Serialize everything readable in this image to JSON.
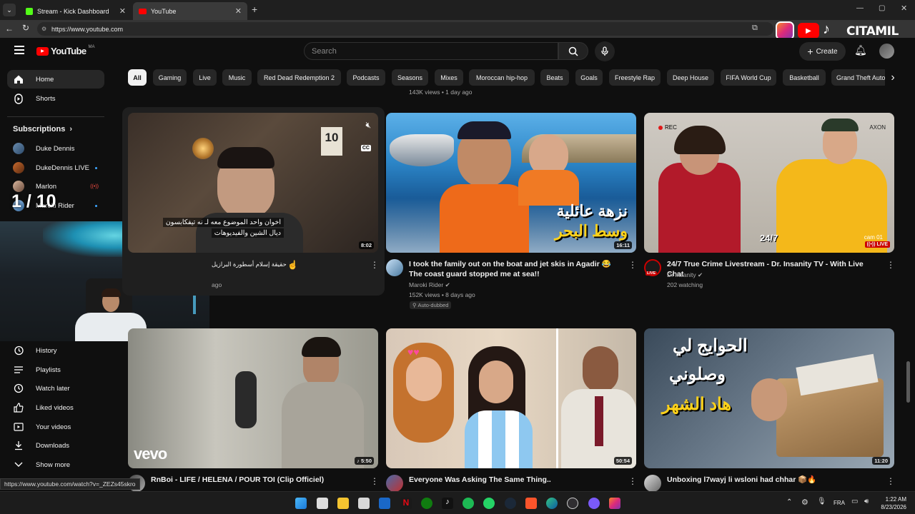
{
  "browser": {
    "tabs": [
      {
        "title": "Stream - Kick Dashboard"
      },
      {
        "title": "YouTube"
      }
    ],
    "url": "https://www.youtube.com",
    "status_url": "https://www.youtube.com/watch?v=_ZEZs45skro"
  },
  "youtube": {
    "logo_text": "YouTube",
    "country": "MA",
    "search_placeholder": "Search",
    "create_label": "Create"
  },
  "sidebar": {
    "home": "Home",
    "shorts": "Shorts",
    "subscriptions_header": "Subscriptions",
    "subscriptions": [
      {
        "name": "Duke Dennis"
      },
      {
        "name": "DukeDennis LIVE"
      },
      {
        "name": "Marlon"
      },
      {
        "name": "Maroki Rider"
      }
    ],
    "you_items": [
      "History",
      "Playlists",
      "Watch later",
      "Liked videos",
      "Your videos",
      "Downloads",
      "Show more"
    ]
  },
  "chips": [
    "All",
    "Gaming",
    "Live",
    "Music",
    "Red Dead Redemption 2",
    "Podcasts",
    "Seasons",
    "Mixes",
    "Moroccan hip-hop",
    "Beats",
    "Goals",
    "Freestyle Rap",
    "Deep House",
    "FIFA World Cup",
    "Basketball",
    "Grand Theft Auto"
  ],
  "overlay": {
    "counter": "1 / 10",
    "top_meta": "143K views • 1 day ago",
    "streamer_name": "CITAMIL"
  },
  "videos": [
    {
      "title": "حقيقة إسلام أسطورة البرازيل",
      "duration": "8:02",
      "meta2": "ago",
      "overlay_line1": "اخوان واحد الموضوع معه لـ نه تيفكابسون",
      "overlay_line2": "ديال الشين والفيديوهات"
    },
    {
      "title": "I took the family out on the boat and jet skis in Agadir 😂 The coast guard stopped me at sea!!",
      "channel": "Maroki Rider",
      "meta": "152K views • 8 days ago",
      "badge": "Auto-dubbed",
      "duration": "16:11",
      "overlay_line1": "نزهة عائلية",
      "overlay_line2": "وسط البحر"
    },
    {
      "title": "24/7 True Crime Livestream - Dr. Insanity TV - With Live Chat",
      "channel": "Dr Insanity",
      "meta": "202 watching",
      "live": "LIVE",
      "rec": "REC",
      "axon": "AXON",
      "cam": "cam 01",
      "clock": "24/7"
    },
    {
      "title": "RnBoi - LIFE / HELENA / POUR TOI (Clip Officiel)",
      "duration": "5:50",
      "brand": "vevo"
    },
    {
      "title": "Everyone Was Asking The Same Thing..",
      "duration": "50:54"
    },
    {
      "title": "Unboxing l7wayj li wsloni had chhar 📦🔥",
      "duration": "11:20",
      "overlay_line1": "الحوايج لي",
      "overlay_line2": "وصلوني",
      "overlay_line3": "هاد الشهر"
    }
  ],
  "taskbar": {
    "lang": "FRA",
    "time": "1:22 AM",
    "date": "8/23/2026"
  }
}
